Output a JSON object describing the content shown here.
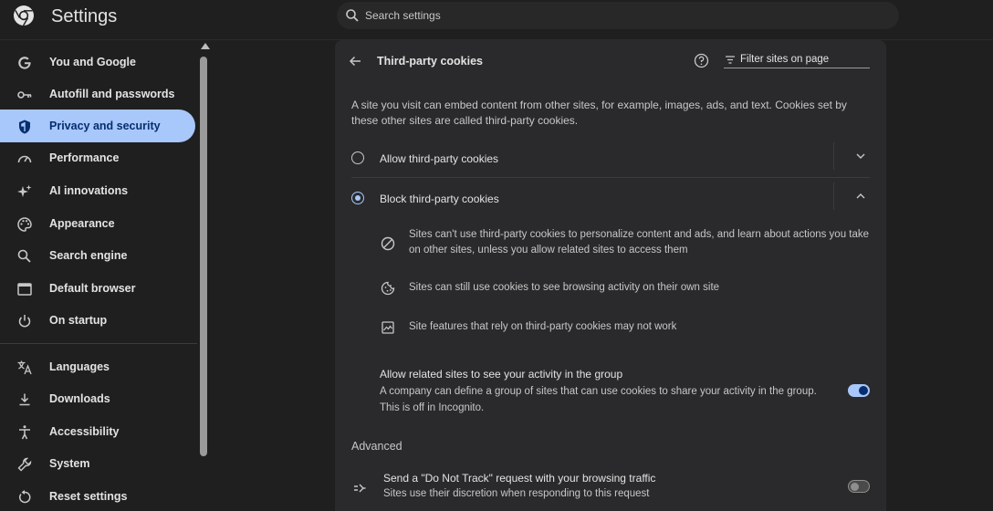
{
  "header": {
    "app_title": "Settings",
    "search_placeholder": "Search settings"
  },
  "sidebar": {
    "active_item": "Privacy and security",
    "items": [
      {
        "label": "You and Google",
        "icon": "google-icon"
      },
      {
        "label": "Autofill and passwords",
        "icon": "key-icon"
      },
      {
        "label": "Privacy and security",
        "icon": "shield-icon"
      },
      {
        "label": "Performance",
        "icon": "speedometer-icon"
      },
      {
        "label": "AI innovations",
        "icon": "sparkle-icon"
      },
      {
        "label": "Appearance",
        "icon": "palette-icon"
      },
      {
        "label": "Search engine",
        "icon": "search-icon"
      },
      {
        "label": "Default browser",
        "icon": "browser-window-icon"
      },
      {
        "label": "On startup",
        "icon": "power-icon"
      },
      {
        "label": "Languages",
        "icon": "translate-icon"
      },
      {
        "label": "Downloads",
        "icon": "download-icon"
      },
      {
        "label": "Accessibility",
        "icon": "accessibility-icon"
      },
      {
        "label": "System",
        "icon": "wrench-icon"
      },
      {
        "label": "Reset settings",
        "icon": "reset-icon"
      }
    ]
  },
  "page": {
    "title": "Third-party cookies",
    "filter_placeholder": "Filter sites on page",
    "description": "A site you visit can embed content from other sites, for example, images, ads, and text. Cookies set by these other sites are called third-party cookies.",
    "options": [
      {
        "label": "Allow third-party cookies",
        "selected": false,
        "expanded": false
      },
      {
        "label": "Block third-party cookies",
        "selected": true,
        "expanded": true
      }
    ],
    "block_details": [
      {
        "icon": "block-icon",
        "text": "Sites can't use third-party cookies to personalize content and ads, and learn about actions you take on other sites, unless you allow related sites to access them"
      },
      {
        "icon": "cookie-icon",
        "text": "Sites can still use cookies to see browsing activity on their own site"
      },
      {
        "icon": "broken-image-icon",
        "text": "Site features that rely on third-party cookies may not work"
      }
    ],
    "related_sites": {
      "title": "Allow related sites to see your activity in the group",
      "description": "A company can define a group of sites that can use cookies to share your activity in the group. This is off in Incognito.",
      "enabled": true
    },
    "advanced_heading": "Advanced",
    "do_not_track": {
      "title": "Send a \"Do Not Track\" request with your browsing traffic",
      "description": "Sites use their discretion when responding to this request",
      "enabled": false
    }
  },
  "colors": {
    "accent": "#a8c7fa",
    "accent_dark": "#062e6f",
    "background": "#1f1f1f",
    "card": "#2a2a2c"
  }
}
